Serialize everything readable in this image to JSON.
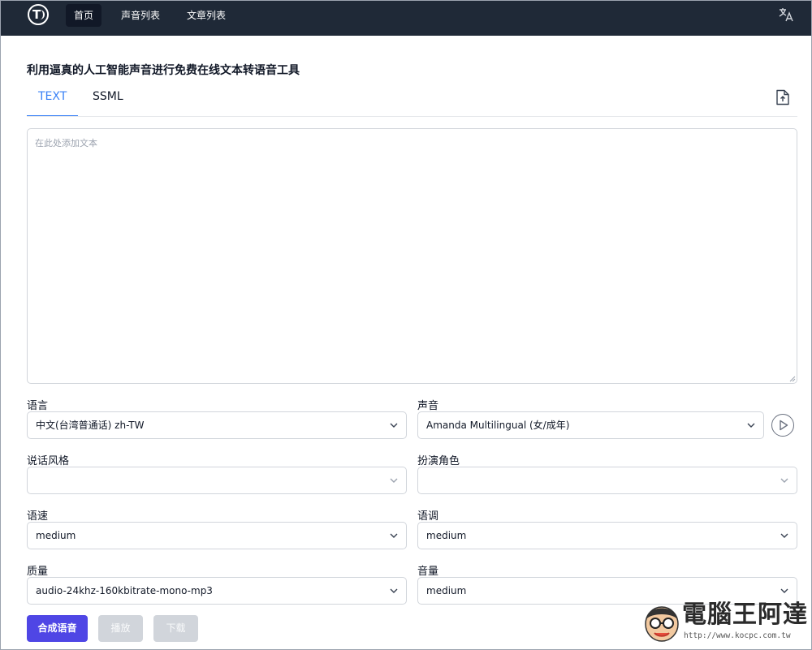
{
  "navbar": {
    "logo_text": "T",
    "items": [
      {
        "label": "首页"
      },
      {
        "label": "声音列表"
      },
      {
        "label": "文章列表"
      }
    ],
    "translate_icon": "translate-icon"
  },
  "page_title": "利用逼真的人工智能声音进行免费在线文本转语音工具",
  "tabs": [
    {
      "label": "TEXT",
      "active": true
    },
    {
      "label": "SSML",
      "active": false
    }
  ],
  "editor": {
    "placeholder": "在此处添加文本",
    "value": ""
  },
  "fields": {
    "language": {
      "label": "语言",
      "value": "中文(台湾普通话) zh-TW"
    },
    "voice": {
      "label": "声音",
      "value": "Amanda Multilingual (女/成年)"
    },
    "style": {
      "label": "说话风格",
      "value": ""
    },
    "role": {
      "label": "扮演角色",
      "value": ""
    },
    "rate": {
      "label": "语速",
      "value": "medium"
    },
    "pitch": {
      "label": "语调",
      "value": "medium"
    },
    "quality": {
      "label": "质量",
      "value": "audio-24khz-160kbitrate-mono-mp3"
    },
    "volume": {
      "label": "音量",
      "value": "medium"
    }
  },
  "buttons": {
    "synthesize": "合成语音",
    "play": "播放",
    "download": "下载"
  },
  "watermark": {
    "name": "電腦王阿達",
    "url": "http://www.kocpc.com.tw"
  },
  "colors": {
    "navbar_bg": "#1f2937",
    "accent": "#3b82f6",
    "primary_button": "#4f46e5",
    "disabled_button": "#d1d5db"
  }
}
